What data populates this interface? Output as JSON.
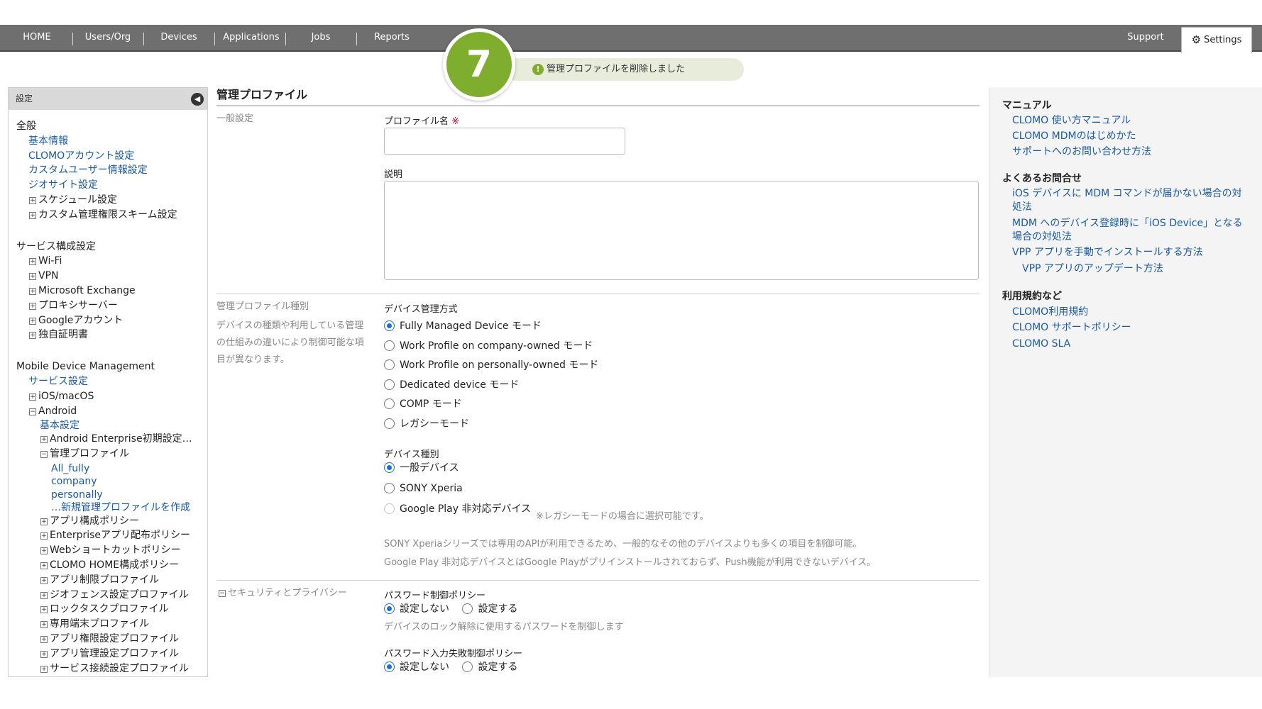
{
  "nav": {
    "items": [
      "HOME",
      "Users/Org",
      "Devices",
      "Applications",
      "Jobs",
      "Reports"
    ],
    "support": "Support",
    "settings": "Settings"
  },
  "overlay": {
    "step": "7",
    "toast": "管理プロファイルを削除しました"
  },
  "sidebar": {
    "header": "設定",
    "lines": [
      {
        "text": "全般",
        "indent": 0,
        "type": "heading"
      },
      {
        "text": "基本情報",
        "indent": 1,
        "type": "link"
      },
      {
        "text": "CLOMOアカウント設定",
        "indent": 1,
        "type": "link"
      },
      {
        "text": "カスタムユーザー情報設定",
        "indent": 1,
        "type": "link"
      },
      {
        "text": "ジオサイト設定",
        "indent": 1,
        "type": "link"
      },
      {
        "text": "スケジュール設定",
        "indent": 1,
        "type": "expander"
      },
      {
        "text": "カスタム管理権限スキーム設定",
        "indent": 1,
        "type": "expander"
      },
      {
        "text": "サービス構成設定",
        "indent": 0,
        "type": "heading"
      },
      {
        "text": "Wi-Fi",
        "indent": 1,
        "type": "expander"
      },
      {
        "text": "VPN",
        "indent": 1,
        "type": "expander"
      },
      {
        "text": "Microsoft Exchange",
        "indent": 1,
        "type": "expander"
      },
      {
        "text": "プロキシサーバー",
        "indent": 1,
        "type": "expander"
      },
      {
        "text": "Googleアカウント",
        "indent": 1,
        "type": "expander"
      },
      {
        "text": "独自証明書",
        "indent": 1,
        "type": "expander"
      },
      {
        "text": "Mobile Device Management",
        "indent": 0,
        "type": "heading"
      },
      {
        "text": "サービス設定",
        "indent": 1,
        "type": "link"
      },
      {
        "text": "iOS/macOS",
        "indent": 1,
        "type": "expander"
      },
      {
        "text": "Android",
        "indent": 1,
        "type": "collapser"
      },
      {
        "text": "基本設定",
        "indent": 2,
        "type": "link"
      },
      {
        "text": "Android Enterprise初期設定…",
        "indent": 2,
        "type": "expander"
      },
      {
        "text": "管理プロファイル",
        "indent": 2,
        "type": "collapser"
      },
      {
        "text": "All_fully",
        "indent": 3,
        "type": "link"
      },
      {
        "text": "company",
        "indent": 3,
        "type": "link"
      },
      {
        "text": "personally",
        "indent": 3,
        "type": "link"
      },
      {
        "text": "…新規管理プロファイルを作成",
        "indent": 3,
        "type": "link"
      },
      {
        "text": "アプリ構成ポリシー",
        "indent": 2,
        "type": "expander"
      },
      {
        "text": "Enterpriseアプリ配布ポリシー",
        "indent": 2,
        "type": "expander"
      },
      {
        "text": "Webショートカットポリシー",
        "indent": 2,
        "type": "expander"
      },
      {
        "text": "CLOMO HOME構成ポリシー",
        "indent": 2,
        "type": "expander"
      },
      {
        "text": "アプリ制限プロファイル",
        "indent": 2,
        "type": "expander"
      },
      {
        "text": "ジオフェンス設定プロファイル",
        "indent": 2,
        "type": "expander"
      },
      {
        "text": "ロックタスクプロファイル",
        "indent": 2,
        "type": "expander"
      },
      {
        "text": "専用端末プロファイル",
        "indent": 2,
        "type": "expander"
      },
      {
        "text": "アプリ権限設定プロファイル",
        "indent": 2,
        "type": "expander"
      },
      {
        "text": "アプリ管理設定プロファイル",
        "indent": 2,
        "type": "expander"
      },
      {
        "text": "サービス接続設定プロファイル",
        "indent": 2,
        "type": "expander"
      }
    ]
  },
  "main": {
    "title": "管理プロファイル",
    "general": {
      "label": "一般設定",
      "name_label": "プロファイル名",
      "required_mark": "※",
      "name_value": "",
      "desc_label": "説明",
      "desc_value": ""
    },
    "type": {
      "label": "管理プロファイル種別",
      "help": [
        "デバイスの種類や利用している管理",
        "の仕組みの違いにより制御可能な項",
        "目が異なります。"
      ],
      "mgmt_label": "デバイス管理方式",
      "mgmt_options": [
        {
          "label": "Fully Managed Device モード",
          "checked": true
        },
        {
          "label": "Work Profile on company-owned モード",
          "checked": false
        },
        {
          "label": "Work Profile on personally-owned モード",
          "checked": false
        },
        {
          "label": "Dedicated device モード",
          "checked": false
        },
        {
          "label": "COMP モード",
          "checked": false
        },
        {
          "label": "レガシーモード",
          "checked": false
        }
      ],
      "devtype_label": "デバイス種別",
      "devtype_options": [
        {
          "label": "一般デバイス",
          "checked": true
        },
        {
          "label": "SONY Xperia",
          "checked": false
        },
        {
          "label": "Google Play 非対応デバイス",
          "checked": false
        }
      ],
      "gp_note": "※レガシーモードの場合に選択可能です。",
      "note1": "SONY Xperiaシリーズでは専用のAPIが利用できるため、一般的なその他のデバイスよりも多くの項目を制御可能。",
      "note2": "Google Play 非対応デバイスとはGoogle Playがプリインストールされておらず、Push機能が利用できないデバイス。"
    },
    "security": {
      "label": "セキュリティとプライバシー",
      "pw_label": "パスワード制御ポリシー",
      "pw_options": [
        {
          "label": "設定しない",
          "checked": true
        },
        {
          "label": "設定する",
          "checked": false
        }
      ],
      "pw_help": "デバイスのロック解除に使用するパスワードを制御します",
      "fail_label": "パスワード入力失敗制御ポリシー",
      "fail_options": [
        {
          "label": "設定しない",
          "checked": true
        },
        {
          "label": "設定する",
          "checked": false
        }
      ]
    }
  },
  "right": {
    "manual_title": "マニュアル",
    "manual_links": [
      "CLOMO 使い方マニュアル",
      "CLOMO MDMのはじめかた",
      "サポートへのお問い合わせ方法"
    ],
    "faq_title": "よくあるお問合せ",
    "faq_links": [
      "iOS デバイスに MDM コマンドが届かない場合の対",
      "処法",
      "MDM へのデバイス登録時に「iOS Device」となる",
      "場合の対処法",
      "VPP アプリを手動でインストールする方法",
      "VPP アプリのアップデート方法"
    ],
    "terms_title": "利用規約など",
    "terms_links": [
      "CLOMO利用規約",
      "CLOMO サポートポリシー",
      "CLOMO SLA"
    ]
  },
  "colors": {
    "nav": "#6f6f6f",
    "link": "#1a5aa8",
    "accent": "#7fae2e",
    "radio": "#1a6fd8"
  }
}
